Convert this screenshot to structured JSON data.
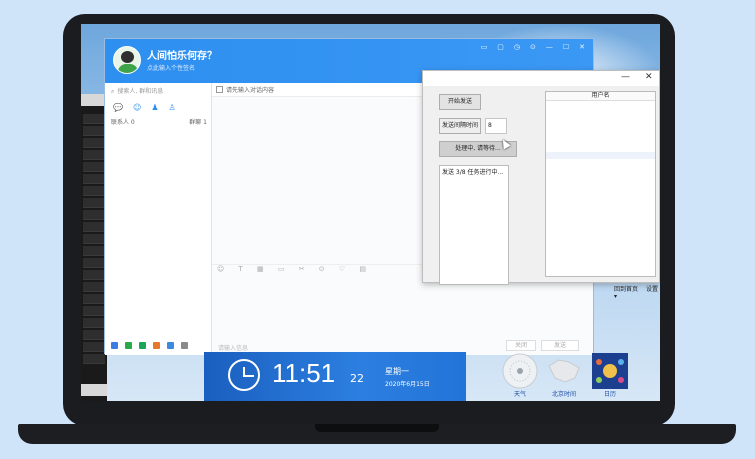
{
  "qq": {
    "name": "人间怕乐何存？",
    "signature": "点此输入个性签名",
    "head_icons": [
      "▭",
      "▢",
      "◷",
      "⊙",
      "—",
      "☐",
      "✕"
    ],
    "search_placeholder": "搜索人, 群和讯息",
    "tab_icons": [
      "💬",
      "☺",
      "♟",
      "♙"
    ],
    "contacts_label": "联系人 0",
    "groups_label": "群聊 1",
    "chat_tag": "请先输入对话内容",
    "input_tools": "☺ T ▦ ▭ ✂ ⊙ ♡ ▤",
    "footer_hint": "请输入信息",
    "close_label": "关闭",
    "send_label": "发送"
  },
  "tool": {
    "start_button": "开始发送",
    "interval_label": "发送间隔时间",
    "interval_value": "8",
    "status_button": "处理中, 请等待...",
    "log_line": "发送 3/8 任务进行中...",
    "list_header": "用户名"
  },
  "clock": {
    "time": "11:51",
    "seconds": "22",
    "weekday": "星期一",
    "date": "2020年6月15日"
  },
  "desktop": {
    "icon1_label": "天气",
    "icon2_label": "北京时间",
    "icon3_label": "日历",
    "link1": "回到首页",
    "link2": "设置 ▾"
  }
}
